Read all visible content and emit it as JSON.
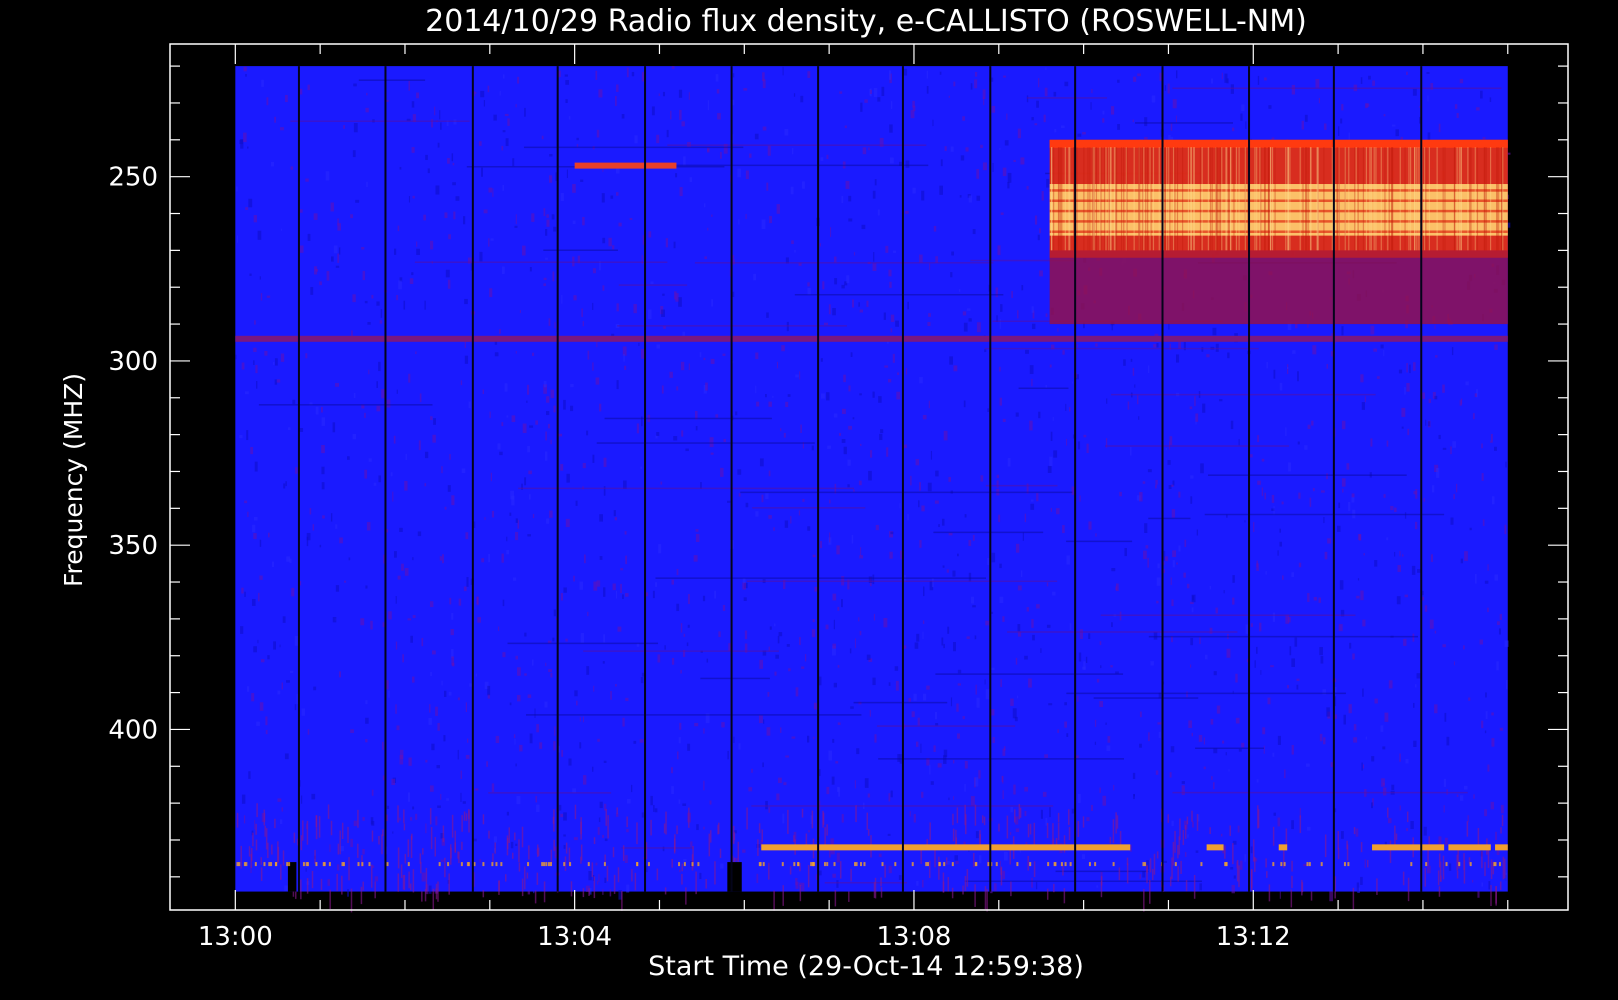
{
  "chart_data": {
    "type": "heatmap",
    "title": "2014/10/29  Radio flux density, e-CALLISTO (ROSWELL-NM)",
    "xlabel": "Start Time (29-Oct-14 12:59:38)",
    "ylabel": "Frequency (MHZ)",
    "x_tick_labels": [
      "13:00",
      "13:04",
      "13:08",
      "13:12"
    ],
    "x_tick_minutes": [
      0,
      4,
      8,
      12
    ],
    "x_range_minutes": [
      -0.77,
      15.71
    ],
    "x_data_range_minutes": [
      0,
      15
    ],
    "y_tick_labels": [
      "250",
      "300",
      "350",
      "400"
    ],
    "y_tick_values": [
      250,
      300,
      350,
      400
    ],
    "y_range_mhz": [
      214,
      449
    ],
    "y_data_range_mhz": [
      220,
      444
    ],
    "y_inverted": true,
    "colors": {
      "background_signal": "#1a1aff",
      "noise": "#6a10b0",
      "burst": "#e83010",
      "burst_peak": "#ffd070",
      "interference": "#f0a030",
      "axis": "#ffffff"
    },
    "features": [
      {
        "kind": "burst",
        "t_start": 9.6,
        "t_end": 15.0,
        "f_low": 240,
        "f_high": 290,
        "core_low": 252,
        "core_high": 266
      },
      {
        "kind": "interference_line",
        "freq": 247,
        "t_start": 4.0,
        "t_end": 5.2
      },
      {
        "kind": "interference_line",
        "freq": 294,
        "t_start": 0,
        "t_end": 15.0
      },
      {
        "kind": "interference_line",
        "freq": 432,
        "t_start": 6.2,
        "t_end": 10.55
      },
      {
        "kind": "interference_line",
        "freq": 432,
        "t_start": 11.45,
        "t_end": 11.65
      },
      {
        "kind": "interference_line",
        "freq": 432,
        "t_start": 12.3,
        "t_end": 12.4
      },
      {
        "kind": "interference_line",
        "freq": 432,
        "t_start": 13.4,
        "t_end": 14.25
      },
      {
        "kind": "interference_line",
        "freq": 432,
        "t_start": 14.3,
        "t_end": 14.8
      },
      {
        "kind": "interference_line",
        "freq": 432,
        "t_start": 14.85,
        "t_end": 15.0
      },
      {
        "kind": "dropout",
        "t_start": 0.62,
        "t_end": 0.72,
        "f_low": 436,
        "f_high": 444
      },
      {
        "kind": "dropout",
        "t_start": 5.8,
        "t_end": 5.97,
        "f_low": 436,
        "f_high": 444
      }
    ],
    "vertical_gaps_minutes": [
      0.75,
      1.77,
      2.8,
      3.8,
      4.83,
      5.85,
      6.87,
      7.87,
      8.9,
      9.9,
      10.93,
      11.95,
      12.95,
      13.98
    ]
  }
}
